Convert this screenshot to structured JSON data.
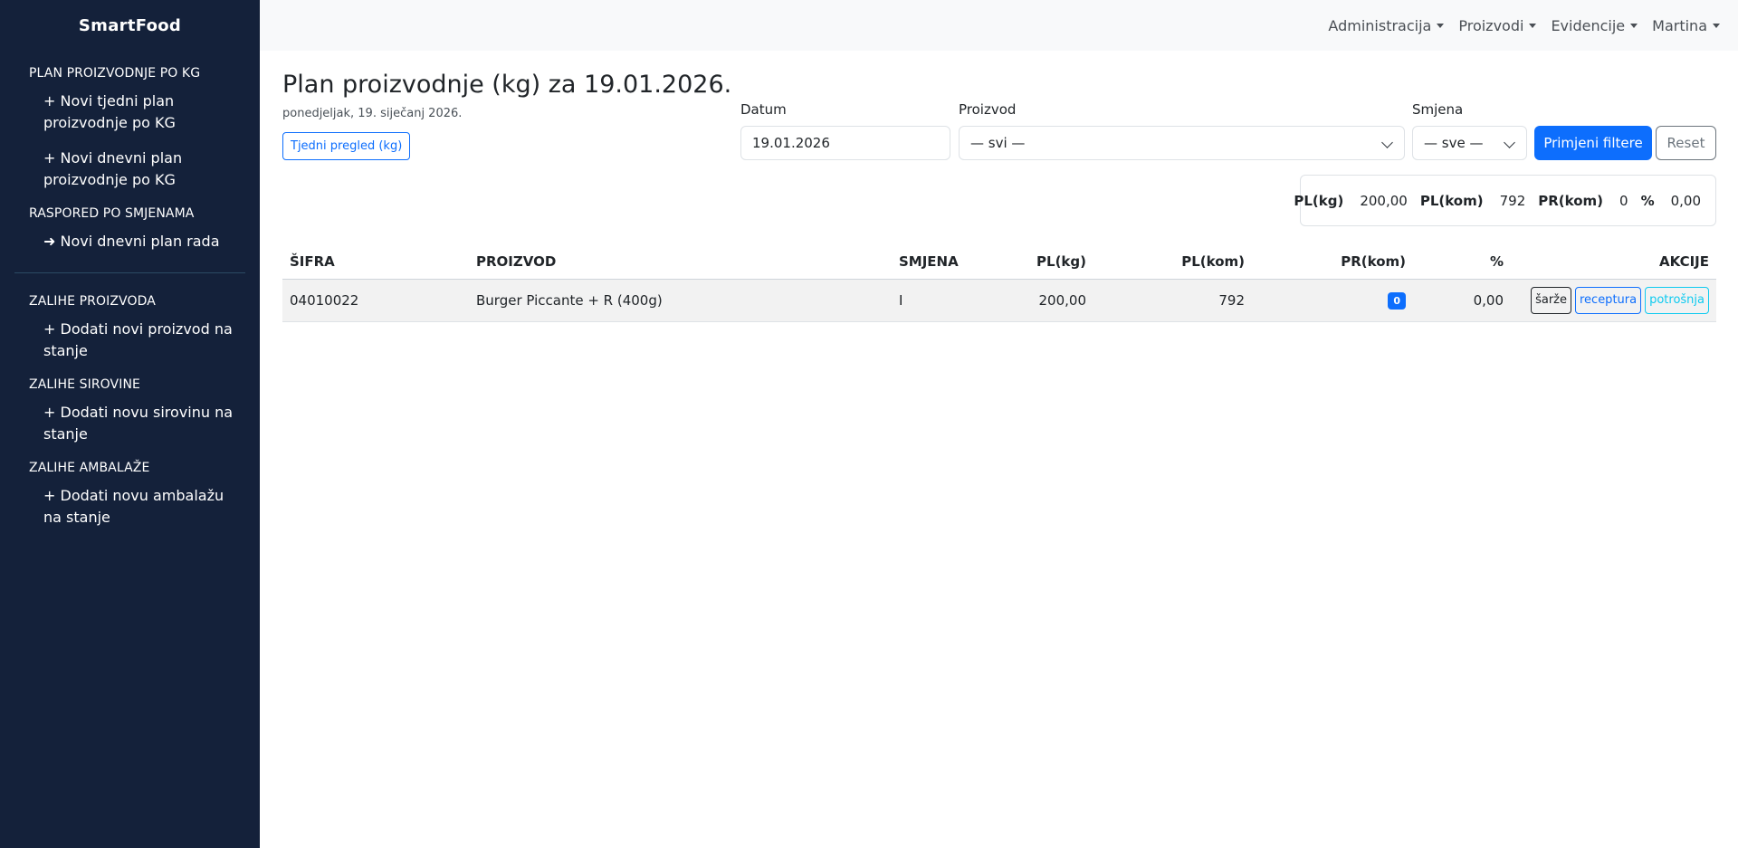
{
  "sidebar": {
    "brand": "SmartFood",
    "sections": [
      {
        "title": "PLAN PROIZVODNJE PO KG",
        "items": [
          "+ Novi tjedni plan proizvodnje po KG",
          "+ Novi dnevni plan proizvodnje po KG"
        ]
      },
      {
        "title": "RASPORED PO SMJENAMA",
        "items": [
          "➜ Novi dnevni plan rada"
        ]
      },
      {
        "title": "ZALIHE PROIZVODA",
        "items": [
          "+ Dodati novi proizvod na stanje"
        ]
      },
      {
        "title": "ZALIHE SIROVINE",
        "items": [
          "+ Dodati novu sirovinu na stanje"
        ]
      },
      {
        "title": "ZALIHE AMBALAŽE",
        "items": [
          "+ Dodati novu ambalažu na stanje"
        ]
      }
    ]
  },
  "topnav": [
    "Administracija",
    "Proizvodi",
    "Evidencije",
    "Martina"
  ],
  "page": {
    "title": "Plan proizvodnje (kg) za 19.01.2026.",
    "subtitle": "ponedjeljak, 19. siječanj 2026.",
    "weekly_button": "Tjedni pregled (kg)"
  },
  "filters": {
    "date_label": "Datum",
    "date_value": "19.01.2026",
    "product_label": "Proizvod",
    "product_value": "— svi —",
    "shift_label": "Smjena",
    "shift_value": "— sve —",
    "apply_label": "Primjeni filtere",
    "reset_label": "Reset"
  },
  "summary": {
    "pl_kg_label": "PL(kg)",
    "pl_kg_value": "200,00",
    "pl_kom_label": "PL(kom)",
    "pl_kom_value": "792",
    "pr_kom_label": "PR(kom)",
    "pr_kom_value": "0",
    "pct_label": "%",
    "pct_value": "0,00"
  },
  "table": {
    "headers": {
      "sifra": "ŠIFRA",
      "proizvod": "PROIZVOD",
      "smjena": "SMJENA",
      "pl_kg": "PL(kg)",
      "pl_kom": "PL(kom)",
      "pr_kom": "PR(kom)",
      "pct": "%",
      "akcije": "AKCIJE"
    },
    "rows": [
      {
        "sifra": "04010022",
        "proizvod": "Burger Piccante + R (400g)",
        "smjena": "I",
        "pl_kg": "200,00",
        "pl_kom": "792",
        "pr_kom": "0",
        "pct": "0,00",
        "actions": [
          "šarže",
          "receptura",
          "potrošnja"
        ]
      }
    ]
  },
  "colors": {
    "sidebar_bg": "#14213a",
    "primary": "#0d6efd",
    "info": "#0dcaf0"
  }
}
